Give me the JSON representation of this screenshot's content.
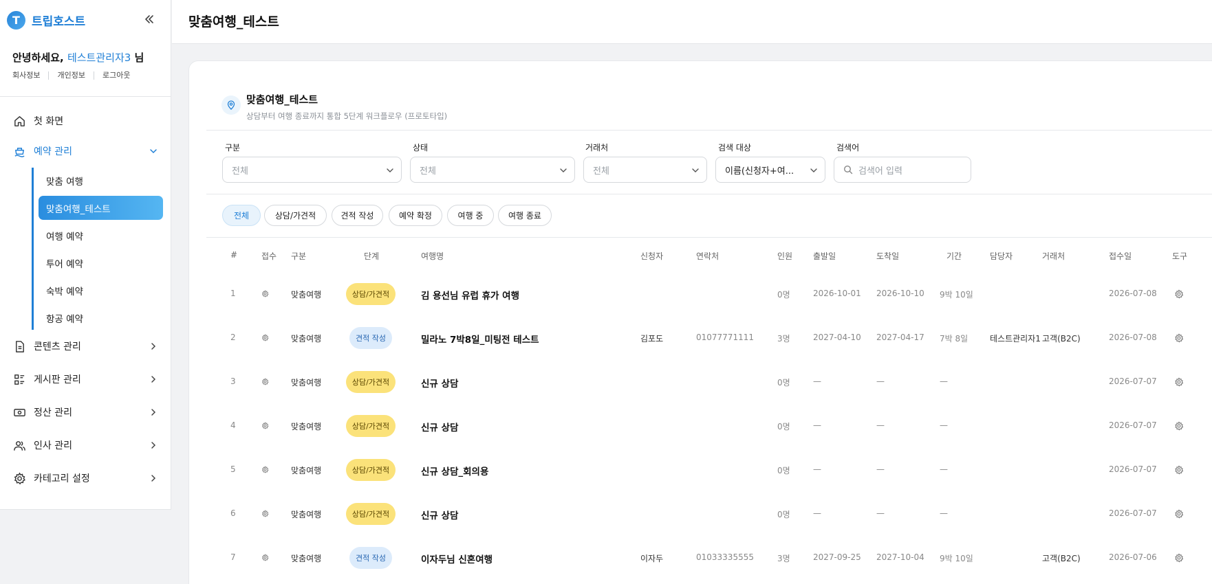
{
  "sidebar": {
    "brand_initial": "T",
    "brand_name": "트립호스트",
    "greeting_prefix": "안녕하세요,",
    "user_name": "테스트관리자3",
    "greeting_suffix": "님",
    "links": [
      "회사정보",
      "개인정보",
      "로그아웃"
    ],
    "nav": [
      {
        "label": "첫 화면",
        "icon": "home-icon"
      },
      {
        "label": "예약 관리",
        "icon": "booking-icon"
      },
      {
        "label": "콘텐츠 관리",
        "icon": "document-icon"
      },
      {
        "label": "게시판 관리",
        "icon": "board-icon"
      },
      {
        "label": "정산 관리",
        "icon": "money-icon"
      },
      {
        "label": "인사 관리",
        "icon": "people-icon"
      },
      {
        "label": "카테고리 설정",
        "icon": "gear-icon"
      }
    ],
    "sub_items": [
      "맞춤 여행",
      "맞춤여행_테스트",
      "여행 예약",
      "투어 예약",
      "숙박 예약",
      "항공 예약"
    ]
  },
  "header": {
    "title": "맞춤여행_테스트"
  },
  "card": {
    "title": "맞춤여행_테스트",
    "subtitle": "상담부터 여행 종료까지 통합 5단계 워크플로우 (프로토타입)"
  },
  "filters": {
    "category": {
      "label": "구분",
      "value": "전체"
    },
    "status": {
      "label": "상태",
      "value": "전체"
    },
    "partner": {
      "label": "거래처",
      "value": "전체"
    },
    "target": {
      "label": "검색 대상",
      "value": "이름(신청자+여..."
    },
    "keyword": {
      "label": "검색어",
      "placeholder": "검색어 입력"
    }
  },
  "chips": [
    "전체",
    "상담/가견적",
    "견적 작성",
    "예약 확정",
    "여행 중",
    "여행 종료"
  ],
  "table": {
    "headers": [
      "#",
      "접수",
      "구분",
      "단계",
      "여행명",
      "신청자",
      "연락처",
      "인원",
      "출발일",
      "도착일",
      "기간",
      "담당자",
      "거래처",
      "접수일",
      "도구"
    ],
    "rows": [
      {
        "no": "1",
        "type": "맞춤여행",
        "stage": "상담/가견적",
        "stage_color": "yellow",
        "name": "김 용선님 유럽 휴가 여행",
        "applicant": "",
        "phone": "",
        "people": "0명",
        "depart": "2026-10-01",
        "arrive": "2026-10-10",
        "period": "9박 10일",
        "manager": "",
        "partner": "",
        "received": "2026-07-08"
      },
      {
        "no": "2",
        "type": "맞춤여행",
        "stage": "견적 작성",
        "stage_color": "blue",
        "name": "밀라노 7박8일_미팅전 테스트",
        "applicant": "김포도",
        "phone": "01077771111",
        "people": "3명",
        "depart": "2027-04-10",
        "arrive": "2027-04-17",
        "period": "7박 8일",
        "manager": "테스트관리자1",
        "partner": "고객(B2C)",
        "received": "2026-07-08"
      },
      {
        "no": "3",
        "type": "맞춤여행",
        "stage": "상담/가견적",
        "stage_color": "yellow",
        "name": "신규 상담",
        "applicant": "",
        "phone": "",
        "people": "0명",
        "depart": "—",
        "arrive": "—",
        "period": "—",
        "manager": "",
        "partner": "",
        "received": "2026-07-07"
      },
      {
        "no": "4",
        "type": "맞춤여행",
        "stage": "상담/가견적",
        "stage_color": "yellow",
        "name": "신규 상담",
        "applicant": "",
        "phone": "",
        "people": "0명",
        "depart": "—",
        "arrive": "—",
        "period": "—",
        "manager": "",
        "partner": "",
        "received": "2026-07-07"
      },
      {
        "no": "5",
        "type": "맞춤여행",
        "stage": "상담/가견적",
        "stage_color": "yellow",
        "name": "신규 상담_회의용",
        "applicant": "",
        "phone": "",
        "people": "0명",
        "depart": "—",
        "arrive": "—",
        "period": "—",
        "manager": "",
        "partner": "",
        "received": "2026-07-07"
      },
      {
        "no": "6",
        "type": "맞춤여행",
        "stage": "상담/가견적",
        "stage_color": "yellow",
        "name": "신규 상담",
        "applicant": "",
        "phone": "",
        "people": "0명",
        "depart": "—",
        "arrive": "—",
        "period": "—",
        "manager": "",
        "partner": "",
        "received": "2026-07-07"
      },
      {
        "no": "7",
        "type": "맞춤여행",
        "stage": "견적 작성",
        "stage_color": "blue",
        "name": "이자두님 신혼여행",
        "applicant": "이자두",
        "phone": "01033335555",
        "people": "3명",
        "depart": "2027-09-25",
        "arrive": "2027-10-04",
        "period": "9박 10일",
        "manager": "",
        "partner": "고객(B2C)",
        "received": "2026-07-06"
      }
    ]
  },
  "colors": {
    "accent": "#1f7fd6",
    "badge_yellow": "#fbe27a",
    "badge_blue": "#dcebfb"
  }
}
